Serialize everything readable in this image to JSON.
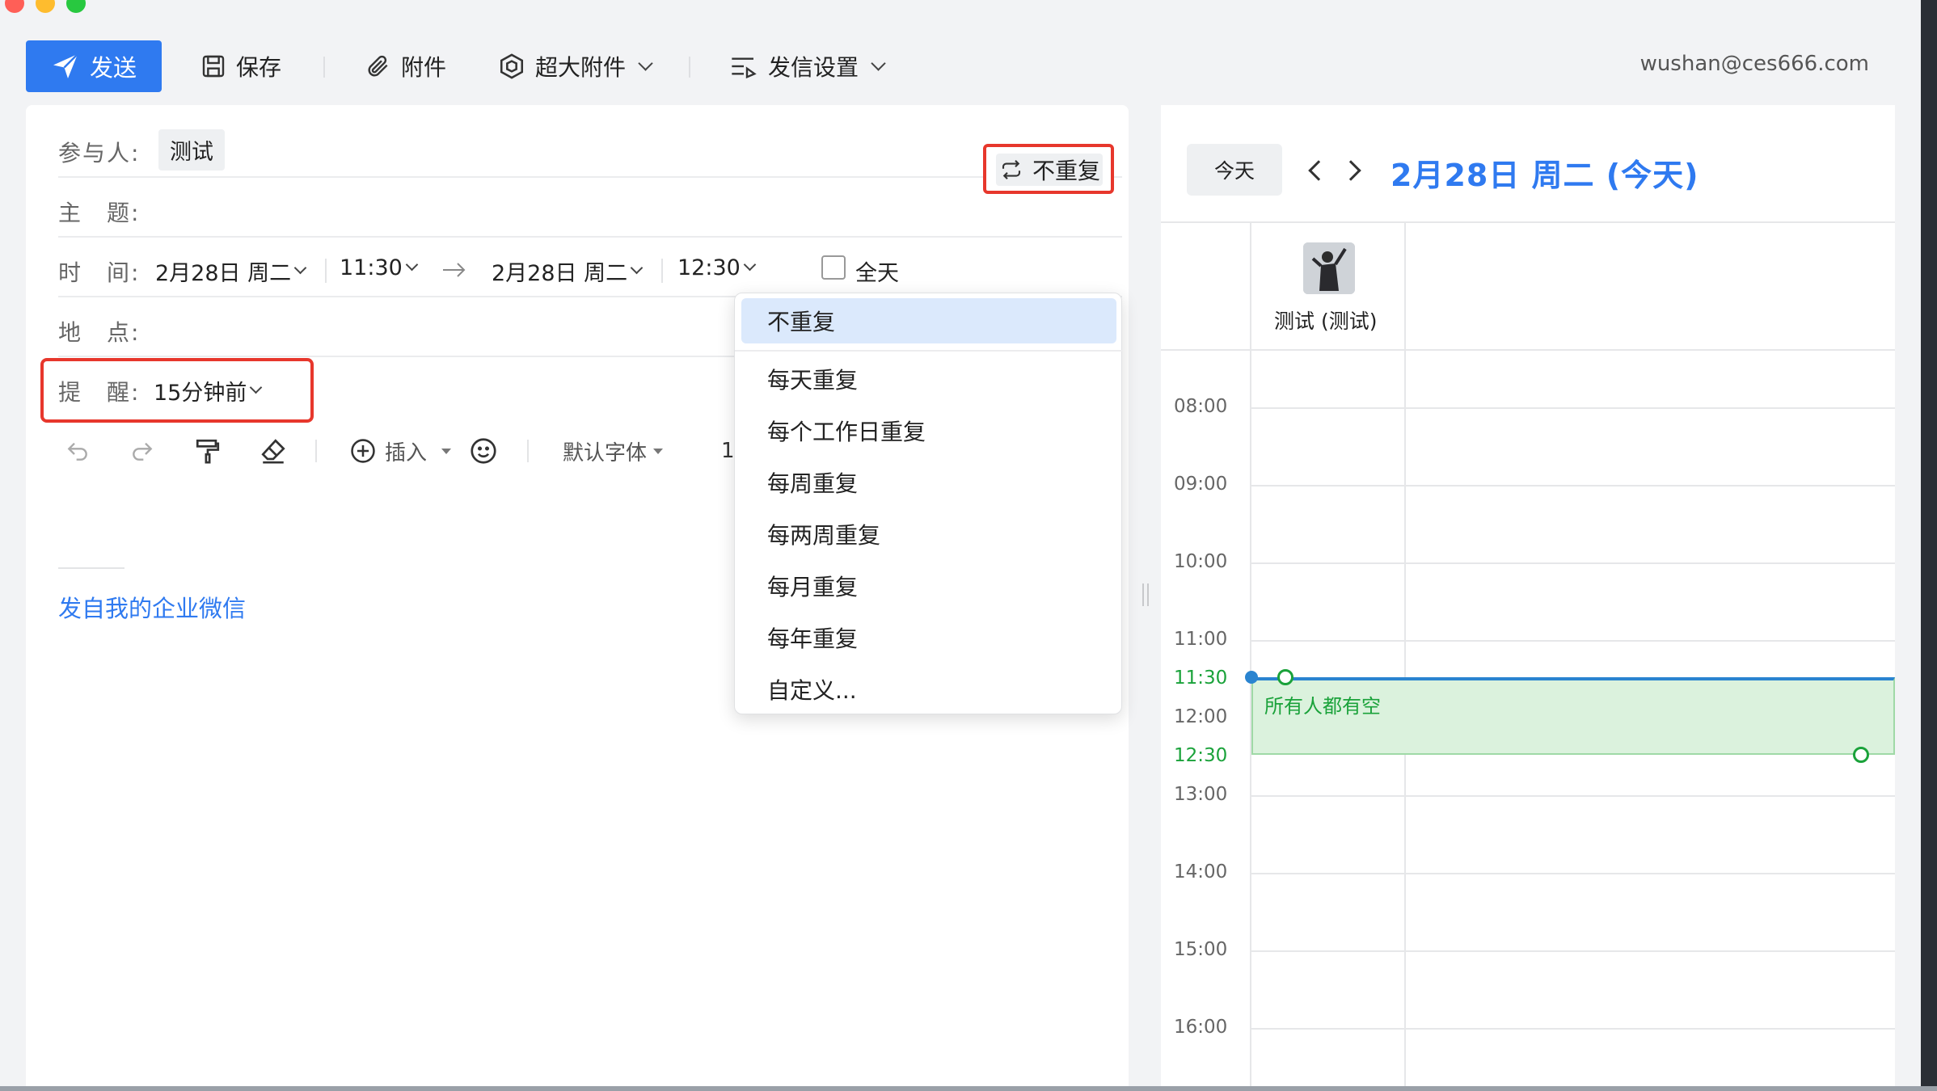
{
  "toolbar": {
    "send_label": "发送",
    "save_label": "保存",
    "attach_label": "附件",
    "big_attach_label": "超大附件",
    "send_settings_label": "发信设置",
    "account": "wushan@ces666.com"
  },
  "form": {
    "participants_label": "参与人:",
    "participant_chip": "测试",
    "subject_label": "主　题:",
    "time_label": "时　间:",
    "start_date": "2月28日 周二",
    "start_time": "11:30",
    "end_date": "2月28日 周二",
    "end_time": "12:30",
    "all_day_label": "全天",
    "repeat_value": "不重复",
    "location_label": "地　点:",
    "reminder_label": "提　醒:",
    "reminder_value": "15分钟前"
  },
  "editor": {
    "insert_label": "插入",
    "font_label": "默认字体",
    "font_size_partial": "1"
  },
  "signature": "发自我的企业微信",
  "repeat_menu": {
    "selected": "不重复",
    "options": [
      "每天重复",
      "每个工作日重复",
      "每周重复",
      "每两周重复",
      "每月重复",
      "每年重复",
      "自定义..."
    ]
  },
  "calendar": {
    "today_button": "今天",
    "title": "2月28日 周二 (今天)",
    "person_name": "测试 (测试)",
    "times": [
      "08:00",
      "09:00",
      "10:00",
      "11:00",
      "11:30",
      "12:00",
      "12:30",
      "13:00",
      "14:00",
      "15:00",
      "16:00"
    ],
    "event_label": "所有人都有空",
    "accent_color": "#2f7af0",
    "free_color": "#1aa23a"
  }
}
